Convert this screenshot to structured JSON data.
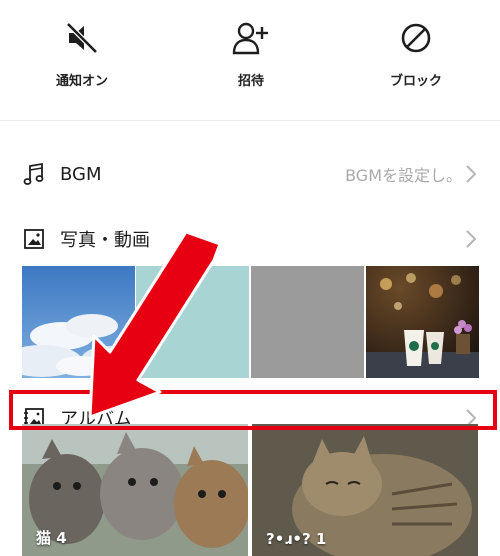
{
  "actions": {
    "notify_label": "通知オン",
    "invite_label": "招待",
    "block_label": "ブロック"
  },
  "rows": {
    "bgm_label": "BGM",
    "bgm_value": "BGMを設定し。",
    "photo_label": "写真・動画",
    "album_label": "アルバム"
  },
  "albums": [
    {
      "caption": "猫 4"
    },
    {
      "caption": "?•ɹ•? 1"
    }
  ],
  "colors": {
    "highlight": "#e60012",
    "arrow": "#e60012"
  },
  "icons": [
    "speaker-mute-icon",
    "add-user-icon",
    "block-icon",
    "music-note-icon",
    "image-icon",
    "album-icon",
    "chevron-right-icon"
  ]
}
